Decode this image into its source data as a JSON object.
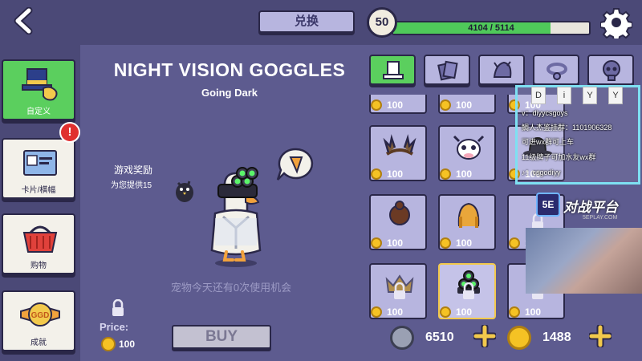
{
  "topbar": {
    "redeem_label": "兑换",
    "level": "50",
    "xp_text": "4104 / 5114",
    "xp_progress": 0.802
  },
  "sidebar": {
    "items": [
      {
        "label": "自定义",
        "icon": "hat-glove-icon",
        "active": true
      },
      {
        "label": "卡片/横幅",
        "icon": "card-icon",
        "active": false
      },
      {
        "label": "购物",
        "icon": "basket-icon",
        "active": false
      },
      {
        "label": "成就",
        "icon": "ggd-badge-icon",
        "active": false
      }
    ],
    "alert": "!"
  },
  "item": {
    "title": "NIGHT VISION GOGGLES",
    "subtitle": "Going Dark",
    "reward_label": "游戏奖励",
    "reward_desc": "为您提供15",
    "pet_usage": "宠物今天还有0次使用机会",
    "price_label": "Price:",
    "price_value": "100",
    "buy_label": "BUY"
  },
  "categories": [
    {
      "icon": "top-hat-icon",
      "active": true
    },
    {
      "icon": "cards-icon",
      "active": false
    },
    {
      "icon": "creature-icon",
      "active": false
    },
    {
      "icon": "collar-icon",
      "active": false
    },
    {
      "icon": "skull-icon",
      "active": false
    }
  ],
  "grid": {
    "top_prices": [
      "100",
      "100",
      "100"
    ],
    "rows": [
      [
        {
          "icon": "antler-crown-icon",
          "price": "100"
        },
        {
          "icon": "cow-hat-icon",
          "price": "100"
        },
        {
          "icon": "bowler-hat-icon",
          "price": "100"
        }
      ],
      [
        {
          "icon": "hair-bun-icon",
          "price": "100"
        },
        {
          "icon": "braided-hair-icon",
          "price": "100"
        },
        {
          "icon": "locked-icon",
          "price": "100"
        }
      ],
      [
        {
          "icon": "locked-crown-icon",
          "price": "100"
        },
        {
          "icon": "night-vision-goggles-icon",
          "price": "100",
          "selected": true
        },
        {
          "icon": "locked-icon",
          "price": "100"
        }
      ]
    ]
  },
  "currency": {
    "silver": "6510",
    "gold": "1488"
  },
  "overlay": {
    "diy_letters": [
      "D",
      "i",
      "Y",
      "Y"
    ],
    "lines": [
      "v：diyycsgoys",
      "鲷人杰鉴挂群：1101906328",
      "可进wx群可上车",
      "11级牌子可加水友wx群",
      "♪：csgodiyy"
    ],
    "brand_logo": "5E",
    "brand_name": "对战平台",
    "brand_url": "5EPLAY.COM"
  }
}
